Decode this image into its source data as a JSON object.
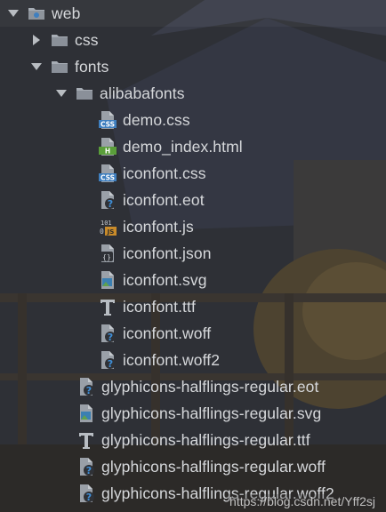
{
  "tree": {
    "items": [
      {
        "label": "web",
        "level": 0,
        "kind": "folder-module",
        "expanded": true
      },
      {
        "label": "css",
        "level": 1,
        "kind": "folder",
        "expanded": false
      },
      {
        "label": "fonts",
        "level": 1,
        "kind": "folder",
        "expanded": true
      },
      {
        "label": "alibabafonts",
        "level": 2,
        "kind": "folder",
        "expanded": true
      },
      {
        "label": "demo.css",
        "level": 3,
        "kind": "css-file"
      },
      {
        "label": "demo_index.html",
        "level": 3,
        "kind": "html-file"
      },
      {
        "label": "iconfont.css",
        "level": 3,
        "kind": "css-file"
      },
      {
        "label": "iconfont.eot",
        "level": 3,
        "kind": "unknown-file"
      },
      {
        "label": "iconfont.js",
        "level": 3,
        "kind": "js-file"
      },
      {
        "label": "iconfont.json",
        "level": 3,
        "kind": "json-file"
      },
      {
        "label": "iconfont.svg",
        "level": 3,
        "kind": "image-file"
      },
      {
        "label": "iconfont.ttf",
        "level": 3,
        "kind": "font-file"
      },
      {
        "label": "iconfont.woff",
        "level": 3,
        "kind": "unknown-file"
      },
      {
        "label": "iconfont.woff2",
        "level": 3,
        "kind": "unknown-file"
      },
      {
        "label": "glyphicons-halflings-regular.eot",
        "level": 2,
        "kind": "unknown-file"
      },
      {
        "label": "glyphicons-halflings-regular.svg",
        "level": 2,
        "kind": "image-file"
      },
      {
        "label": "glyphicons-halflings-regular.ttf",
        "level": 2,
        "kind": "font-file"
      },
      {
        "label": "glyphicons-halflings-regular.woff",
        "level": 2,
        "kind": "unknown-file"
      },
      {
        "label": "glyphicons-halflings-regular.woff2",
        "level": 2,
        "kind": "unknown-file"
      }
    ]
  },
  "watermark": "https://blog.csdn.net/Yff2sj",
  "colors": {
    "text": "#d6d8db",
    "folder": "#a7adb5",
    "css_badge": "#3f7fbf",
    "html_badge": "#5a9e3a",
    "js_badge": "#c98b2a",
    "background": "#2f3136"
  }
}
